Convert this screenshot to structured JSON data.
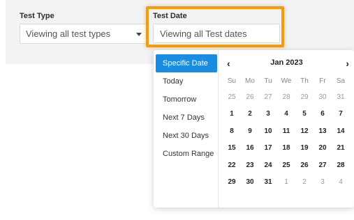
{
  "filters": {
    "test_type": {
      "label": "Test Type",
      "value": "Viewing all test types"
    },
    "test_date": {
      "label": "Test Date",
      "value": "Viewing all Test dates"
    }
  },
  "picker": {
    "ranges": [
      "Specific Date",
      "Today",
      "Tomorrow",
      "Next 7 Days",
      "Next 30 Days",
      "Custom Range"
    ],
    "active_range": "Specific Date",
    "calendar": {
      "month_label": "Jan 2023",
      "prev_icon": "chevron-left-icon",
      "next_icon": "chevron-right-icon",
      "weekdays": [
        "Su",
        "Mo",
        "Tu",
        "We",
        "Th",
        "Fr",
        "Sa"
      ],
      "weeks": [
        [
          "25",
          "26",
          "27",
          "28",
          "29",
          "30",
          "31"
        ],
        [
          "1",
          "2",
          "3",
          "4",
          "5",
          "6",
          "7"
        ],
        [
          "8",
          "9",
          "10",
          "11",
          "12",
          "13",
          "14"
        ],
        [
          "15",
          "16",
          "17",
          "18",
          "19",
          "20",
          "21"
        ],
        [
          "22",
          "23",
          "24",
          "25",
          "26",
          "27",
          "28"
        ],
        [
          "29",
          "30",
          "31",
          "1",
          "2",
          "3",
          "4"
        ]
      ]
    }
  },
  "colors": {
    "highlight": "#f39c12",
    "active_range": "#1a8de3"
  }
}
